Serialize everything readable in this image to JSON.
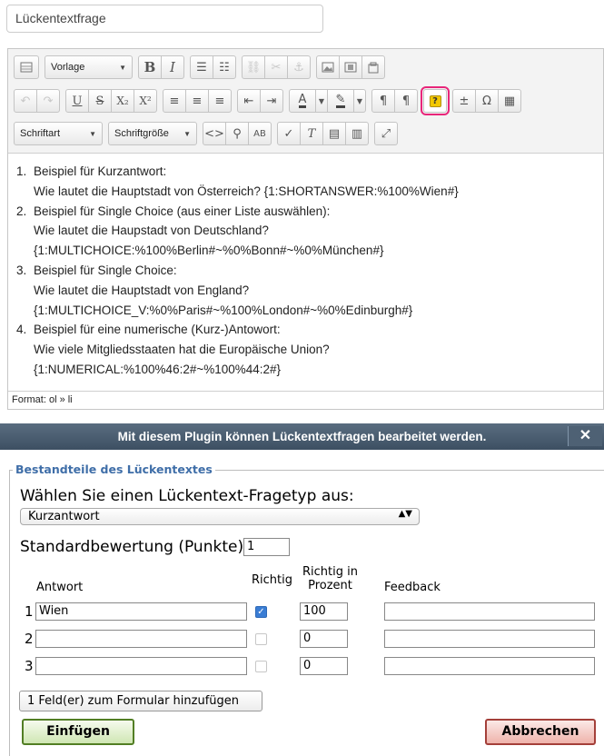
{
  "question_title": "Lückentextfrage",
  "toolbar": {
    "style_select": "Vorlage",
    "font_select": "Schriftart",
    "size_select": "Schriftgröße",
    "bold": "B",
    "italic": "I",
    "underline": "U",
    "strike": "S",
    "subscript": "X₂",
    "superscript": "X²",
    "question_icon": "?",
    "omega": "Ω",
    "pilcrow": "¶"
  },
  "content": {
    "items": [
      {
        "line1": "Beispiel für Kurzantwort:",
        "line2": "Wie lautet die Hauptstadt von Österreich? {1:SHORTANSWER:%100%Wien#}",
        "line3": ""
      },
      {
        "line1": "Beispiel für Single Choice (aus einer Liste auswählen):",
        "line2": "Wie lautet die Haupstadt von Deutschland?",
        "line3": "{1:MULTICHOICE:%100%Berlin#~%0%Bonn#~%0%München#}"
      },
      {
        "line1": "Beispiel für Single Choice:",
        "line2": "Wie lautet die Hauptstadt von England?",
        "line3": "{1:MULTICHOICE_V:%0%Paris#~%100%London#~%0%Edinburgh#}"
      },
      {
        "line1": "Beispiel für eine numerische (Kurz-)Antowort:",
        "line2": "Wie viele Mitgliedsstaaten hat die Europäische Union?",
        "line3": "{1:NUMERICAL:%100%46:2#~%100%44:2#}"
      }
    ]
  },
  "statusbar": "Format: ol » li",
  "dialog": {
    "title": "Mit diesem Plugin können Lückentextfragen bearbeitet werden.",
    "close": "✕",
    "legend": "Bestandteile des Lückentextes",
    "type_label": "Wählen Sie einen Lückentext-Fragetyp aus:",
    "type_value": "Kurzantwort",
    "score_label": "Standardbewertung (Punkte)",
    "score_value": "1",
    "col_answer": "Antwort",
    "col_correct": "Richtig",
    "col_percent_1": "Richtig in",
    "col_percent_2": "Prozent",
    "col_feedback": "Feedback",
    "rows": [
      {
        "num": "1",
        "answer": "Wien",
        "checked": true,
        "percent": "100",
        "feedback": ""
      },
      {
        "num": "2",
        "answer": "",
        "checked": false,
        "percent": "0",
        "feedback": ""
      },
      {
        "num": "3",
        "answer": "",
        "checked": false,
        "percent": "0",
        "feedback": ""
      }
    ],
    "add_fields": "1 Feld(er) zum Formular hinzufügen",
    "insert": "Einfügen",
    "cancel": "Abbrechen"
  }
}
